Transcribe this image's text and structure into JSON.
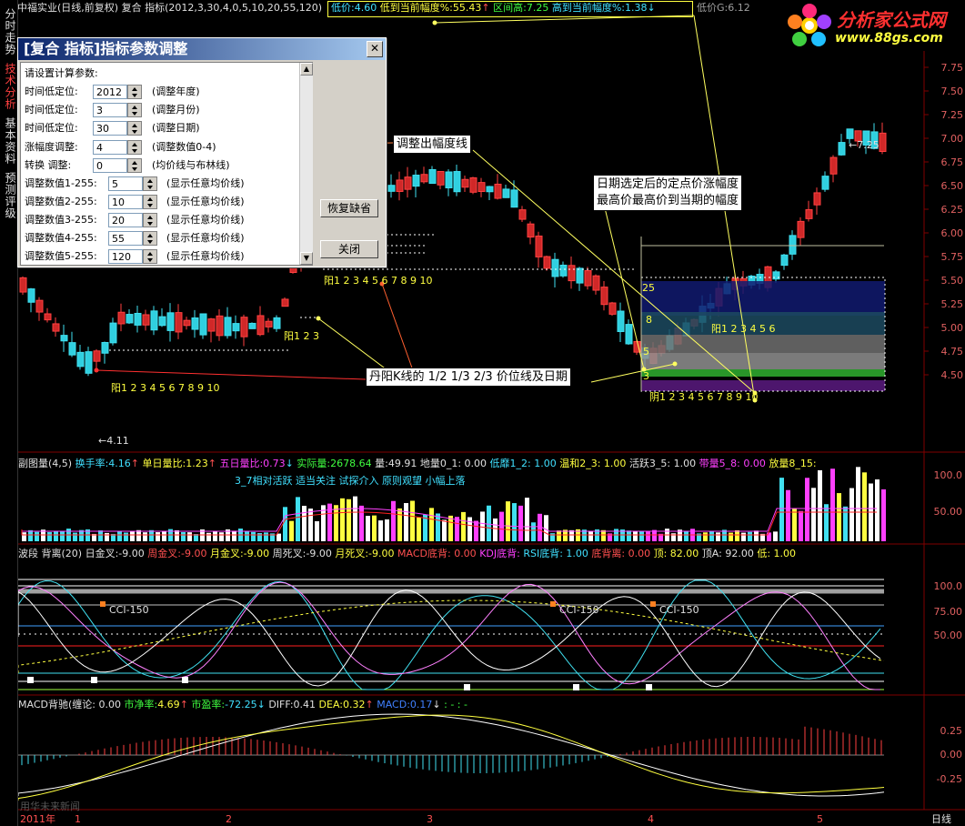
{
  "sidebar": {
    "tabs": [
      {
        "label": "分时走势"
      },
      {
        "label": "技术分析"
      },
      {
        "label": "基本资料"
      },
      {
        "label": "预测评级"
      }
    ]
  },
  "top": {
    "stock": "中福实业(日线,前复权) 复合 指标(2012,3,30,4,0,5,10,20,55,120)",
    "low_price_label": "低价:",
    "low_price": "4.60",
    "low_to_now_label": "低到当前幅度%:",
    "low_to_now": "55.43",
    "range_high_label": "区间高:",
    "range_high": "7.25",
    "high_to_now_label": "高到当前幅度%:",
    "high_to_now": "1.38",
    "lowG_label": "低价G:",
    "lowG": "6.12"
  },
  "logo": {
    "name": "分析家公式网",
    "url": "www.88gs.com"
  },
  "price_axis": [
    "7.75",
    "7.50",
    "7.25",
    "7.00",
    "6.75",
    "6.50",
    "6.25",
    "6.00",
    "5.75",
    "5.50",
    "5.25",
    "5.00",
    "4.75",
    "4.50"
  ],
  "main_chart": {
    "low_mark": "4.11",
    "high_mark": "7.25",
    "count_labels": [
      "阳1 2 3 4 5 6 7 8 9 10",
      "阳1 2 3",
      "阳1 2 3 4 5 6 7 8 9 10",
      "阳1 2 3 4 5 6",
      "阴1 2 3 4 5 6 7 8 9 10"
    ],
    "band_labels": [
      "25",
      "8",
      "5",
      "3"
    ]
  },
  "dialog": {
    "title": "[复合 指标]指标参数调整",
    "close_glyph": "✕",
    "prompt": "请设置计算参数:",
    "params": [
      {
        "label": "时间低定位:",
        "value": "2012",
        "note": "(调整年度)"
      },
      {
        "label": "时间低定位:",
        "value": "3",
        "note": "(调整月份)"
      },
      {
        "label": "时间低定位:",
        "value": "30",
        "note": "(调整日期)"
      },
      {
        "label": "涨幅度调整:",
        "value": "4",
        "note": "(调整数值0-4)"
      },
      {
        "label": "转换  调整:",
        "value": "0",
        "note": "(均价线与布林线)"
      },
      {
        "label": "调整数值1-255:",
        "value": "5",
        "note": "(显示任意均价线)"
      },
      {
        "label": "调整数值2-255:",
        "value": "10",
        "note": "(显示任意均价线)"
      },
      {
        "label": "调整数值3-255:",
        "value": "20",
        "note": "(显示任意均价线)"
      },
      {
        "label": "调整数值4-255:",
        "value": "55",
        "note": "(显示任意均价线)"
      },
      {
        "label": "调整数值5-255:",
        "value": "120",
        "note": "(显示任意均价线)"
      }
    ],
    "restore_button": "恢复缺省",
    "close_button": "关闭"
  },
  "callouts": {
    "amplitude_line": "调整出幅度线",
    "date_note_1": "日期选定后的定点价涨幅度",
    "date_note_2": "最高价最高价到当期的幅度",
    "danyang": "丹阳K线的 1/2 1/3 2/3 价位线及日期"
  },
  "volume_panel": {
    "title": "副图量(4,5)",
    "turnover_label": "换手率:",
    "turnover": "4.16",
    "single_ratio_label": "单日量比:",
    "single_ratio": "1.23",
    "five_ratio_label": "五日量比:",
    "five_ratio": "0.73",
    "actual_label": "实际量:",
    "actual": "2678.64",
    "volume_label": "量:",
    "volume": "49.91",
    "low0_1": "地量0_1: 0.00",
    "low1_2": "低靡1_2: 1.00",
    "mild2_3": "温和2_3: 1.00",
    "active3_5": "活跃3_5: 1.00",
    "heavy5_8": "带量5_8: 0.00",
    "huge8_15": "放量8_15:",
    "comment": "3_7相对活跃 适当关注 试探介入 原则观望 小幅上落",
    "axis": [
      "100.0",
      "50.00"
    ]
  },
  "wave_panel": {
    "title": "波段 背离(20)",
    "items": [
      {
        "label": "日金叉:",
        "value": "-9.00"
      },
      {
        "label": "周金叉:",
        "value": "-9.00"
      },
      {
        "label": "月金叉:",
        "value": "-9.00"
      },
      {
        "label": "周死叉:",
        "value": "-9.00"
      },
      {
        "label": "月死叉:",
        "value": "-9.00"
      }
    ],
    "macd_div": "MACD底背: 0.00",
    "kdj_div": "KDJ底背:",
    "rsi_div": "RSI底背: 1.00",
    "bottom_div": "底背离: 0.00",
    "top": "顶: 82.00",
    "topA": "顶A: 92.00",
    "low": "低: 1.00",
    "cci_labels": [
      "CCI-150",
      "CCI-150",
      "CCI-150"
    ],
    "axis": [
      "100.0",
      "75.00",
      "50.00"
    ]
  },
  "macd_panel": {
    "title": "MACD背驰(缠论",
    "title_val": ": 0.00",
    "pb_label": "市净率:",
    "pb": "4.69",
    "pe_label": "市盈率:",
    "pe": "-72.25",
    "diff_label": "DIFF:",
    "diff": "0.41",
    "dea_label": "DEA:",
    "dea": "0.32",
    "macd_label": "MACD:",
    "macd": "0.17",
    "tail": ": - : -",
    "axis": [
      "0.25",
      "0.00",
      "-0.25"
    ]
  },
  "bottom": {
    "year": "2011年",
    "months": [
      "1",
      "2",
      "3",
      "4",
      "5"
    ],
    "period": "日线",
    "watermark": "用华未来新闻"
  }
}
